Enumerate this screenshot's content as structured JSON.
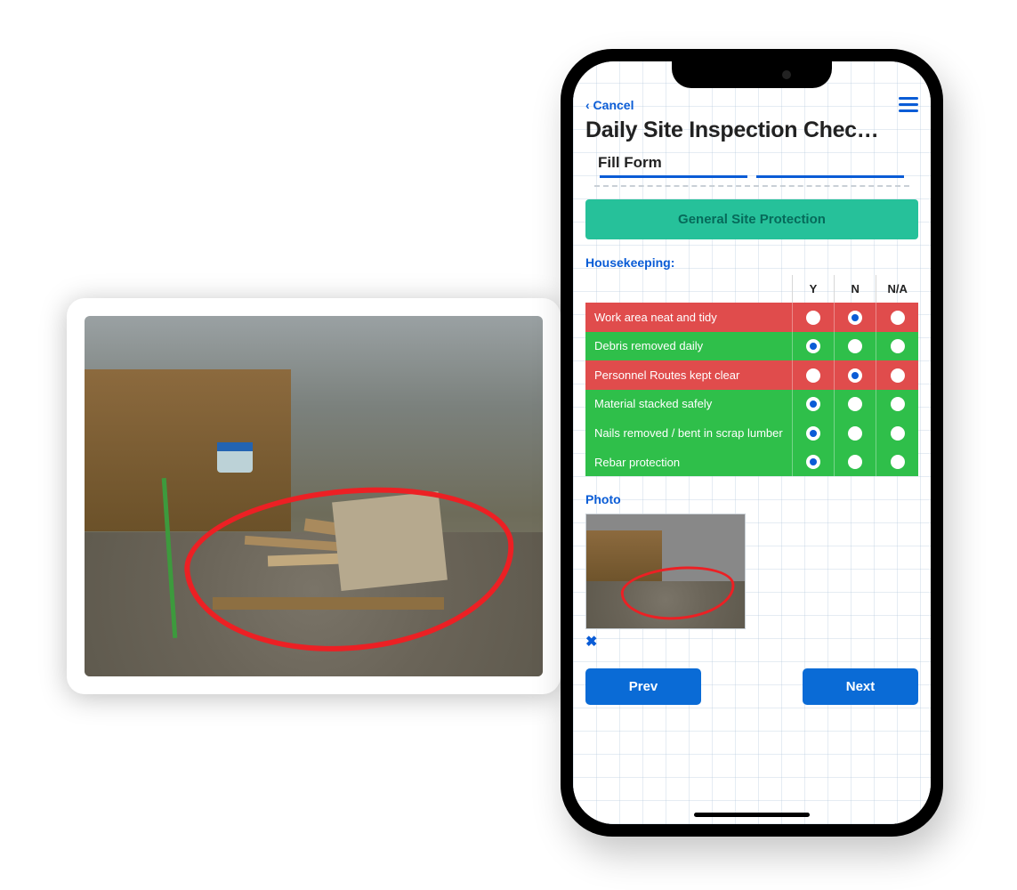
{
  "screen": {
    "cancel": "‹ Cancel",
    "title": "Daily Site Inspection Chec…",
    "subhead": "Fill Form",
    "banner": "General Site Protection",
    "section": "Housekeeping:",
    "columns": {
      "y": "Y",
      "n": "N",
      "na": "N/A"
    },
    "rows": [
      {
        "label": "Work area neat and tidy",
        "status": "red",
        "selected": "n"
      },
      {
        "label": "Debris removed daily",
        "status": "green",
        "selected": "y"
      },
      {
        "label": "Personnel Routes kept clear",
        "status": "red",
        "selected": "n"
      },
      {
        "label": "Material stacked safely",
        "status": "green",
        "selected": "y"
      },
      {
        "label": "Nails removed / bent in scrap lumber",
        "status": "green",
        "selected": "y"
      },
      {
        "label": "Rebar protection",
        "status": "green",
        "selected": "y"
      }
    ],
    "photo_label": "Photo",
    "delete_glyph": "✖",
    "prev": "Prev",
    "next": "Next"
  }
}
